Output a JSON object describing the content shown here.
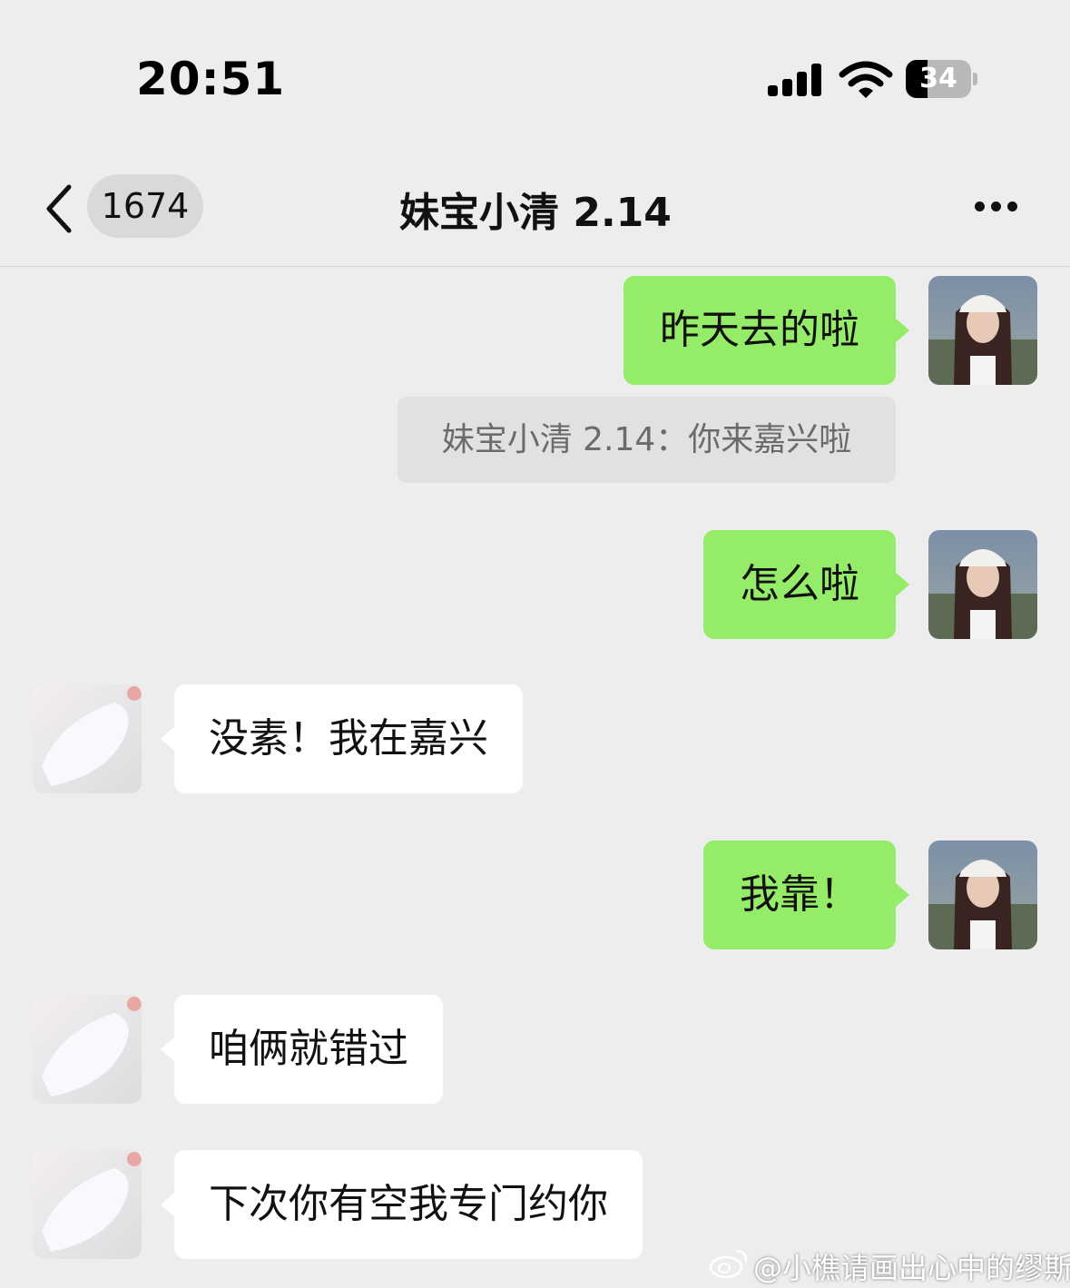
{
  "status_bar": {
    "time": "20:51",
    "battery_level": "34",
    "battery_fraction": 0.34,
    "icons": [
      "cellular-signal-icon",
      "wifi-icon",
      "battery-icon"
    ]
  },
  "nav": {
    "unread_count": "1674",
    "title": "妹宝小清 2.14",
    "icons": [
      "back-chevron-icon",
      "more-dots-icon"
    ]
  },
  "messages": [
    {
      "sender": "me",
      "text": "昨天去的啦"
    },
    {
      "sender": "quote",
      "text": "妹宝小清 2.14：你来嘉兴啦"
    },
    {
      "sender": "me",
      "text": "怎么啦"
    },
    {
      "sender": "them",
      "text": "没素！我在嘉兴"
    },
    {
      "sender": "me",
      "text": "我靠！"
    },
    {
      "sender": "them",
      "text": "咱俩就错过"
    },
    {
      "sender": "them",
      "text": "下次你有空我专门约你"
    }
  ],
  "watermark": "@小樵请画出心中的缪斯",
  "colors": {
    "background": "#ededed",
    "my_bubble": "#95ec69",
    "their_bubble": "#ffffff",
    "quote_bg": "#e1e1e1",
    "quote_text": "#6b6b6b"
  }
}
